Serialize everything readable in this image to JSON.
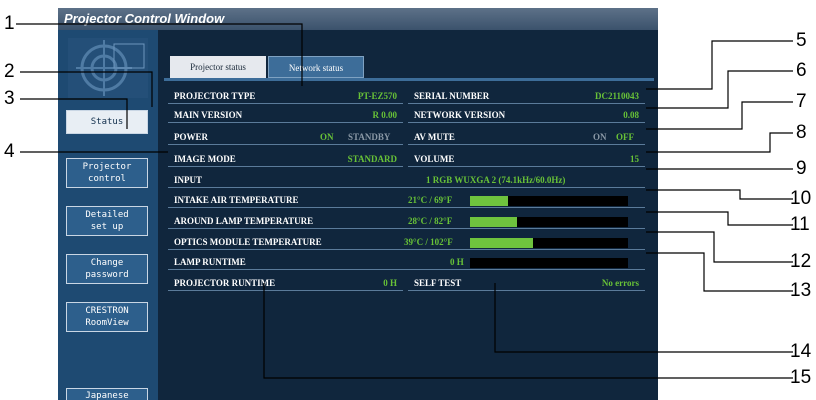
{
  "window": {
    "title": "Projector Control Window"
  },
  "sidebar": {
    "buttons": [
      {
        "label": "Status"
      },
      {
        "label": "Projector\ncontrol"
      },
      {
        "label": "Detailed\nset up"
      },
      {
        "label": "Change\npassword"
      },
      {
        "label": "CRESTRON\nRoomView"
      },
      {
        "label": "Japanese"
      }
    ]
  },
  "tabs": [
    {
      "label": "Projector status"
    },
    {
      "label": "Network status"
    }
  ],
  "status": {
    "projector_type": {
      "label": "PROJECTOR TYPE",
      "value": "PT-EZ570"
    },
    "main_version": {
      "label": "MAIN VERSION",
      "value": "R 0.00"
    },
    "power": {
      "label": "POWER",
      "on": "ON",
      "standby": "STANDBY"
    },
    "image_mode": {
      "label": "IMAGE MODE",
      "value": "STANDARD"
    },
    "serial_number": {
      "label": "SERIAL NUMBER",
      "value": "DC2110043"
    },
    "network_version": {
      "label": "NETWORK VERSION",
      "value": "0.08"
    },
    "av_mute": {
      "label": "AV MUTE",
      "on": "ON",
      "off": "OFF"
    },
    "volume": {
      "label": "VOLUME",
      "value": "15"
    },
    "input": {
      "label": "INPUT",
      "value": "1 RGB   WUXGA 2 (74.1kHz/60.0Hz)"
    },
    "intake_temp": {
      "label": "INTAKE AIR TEMPERATURE",
      "value": "21°C / 69°F",
      "level": 0.24
    },
    "lamp_temp": {
      "label": "AROUND LAMP TEMPERATURE",
      "value": "28°C / 82°F",
      "level": 0.3
    },
    "optics_temp": {
      "label": "OPTICS MODULE TEMPERATURE",
      "value": "39°C / 102°F",
      "level": 0.4
    },
    "lamp_runtime": {
      "label": "LAMP RUNTIME",
      "value": "0 H",
      "level": 0
    },
    "projector_runtime": {
      "label": "PROJECTOR RUNTIME",
      "value": "0 H"
    },
    "self_test": {
      "label": "SELF TEST",
      "value": "No errors"
    }
  },
  "callouts": [
    "1",
    "2",
    "3",
    "4",
    "5",
    "6",
    "7",
    "8",
    "9",
    "10",
    "11",
    "12",
    "13",
    "14",
    "15"
  ],
  "colors": {
    "value_green": "#68c237",
    "bar_green": "#6fc33e",
    "background": "#10263d"
  }
}
